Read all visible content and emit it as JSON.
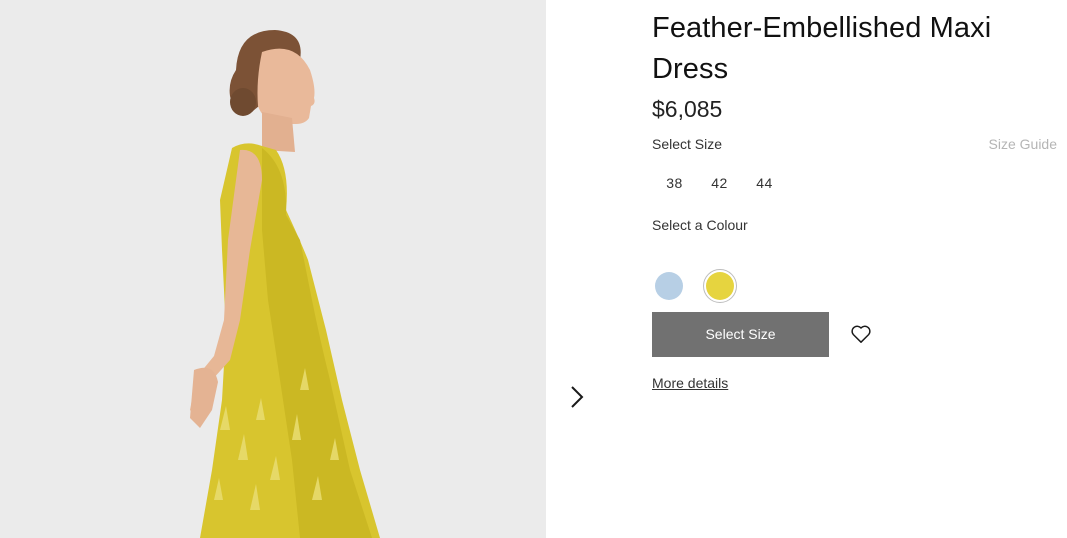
{
  "product": {
    "title": "Feather-Embellished Maxi Dress",
    "price": "$6,085"
  },
  "size": {
    "label": "Select Size",
    "guide_label": "Size Guide",
    "options": [
      "38",
      "42",
      "44"
    ]
  },
  "colour": {
    "label": "Select a Colour",
    "swatches": [
      {
        "name": "light-blue",
        "color": "#b7cfe5",
        "selected": false
      },
      {
        "name": "yellow",
        "color": "#e6d43f",
        "selected": true
      }
    ]
  },
  "actions": {
    "select_size_button": "Select Size",
    "wishlist_icon": "heart-icon",
    "more_details": "More details"
  },
  "gallery": {
    "next_icon": "chevron-right-icon"
  },
  "colors": {
    "button_bg": "#717171",
    "image_bg": "#ebebeb",
    "dress": "#d4c431"
  }
}
